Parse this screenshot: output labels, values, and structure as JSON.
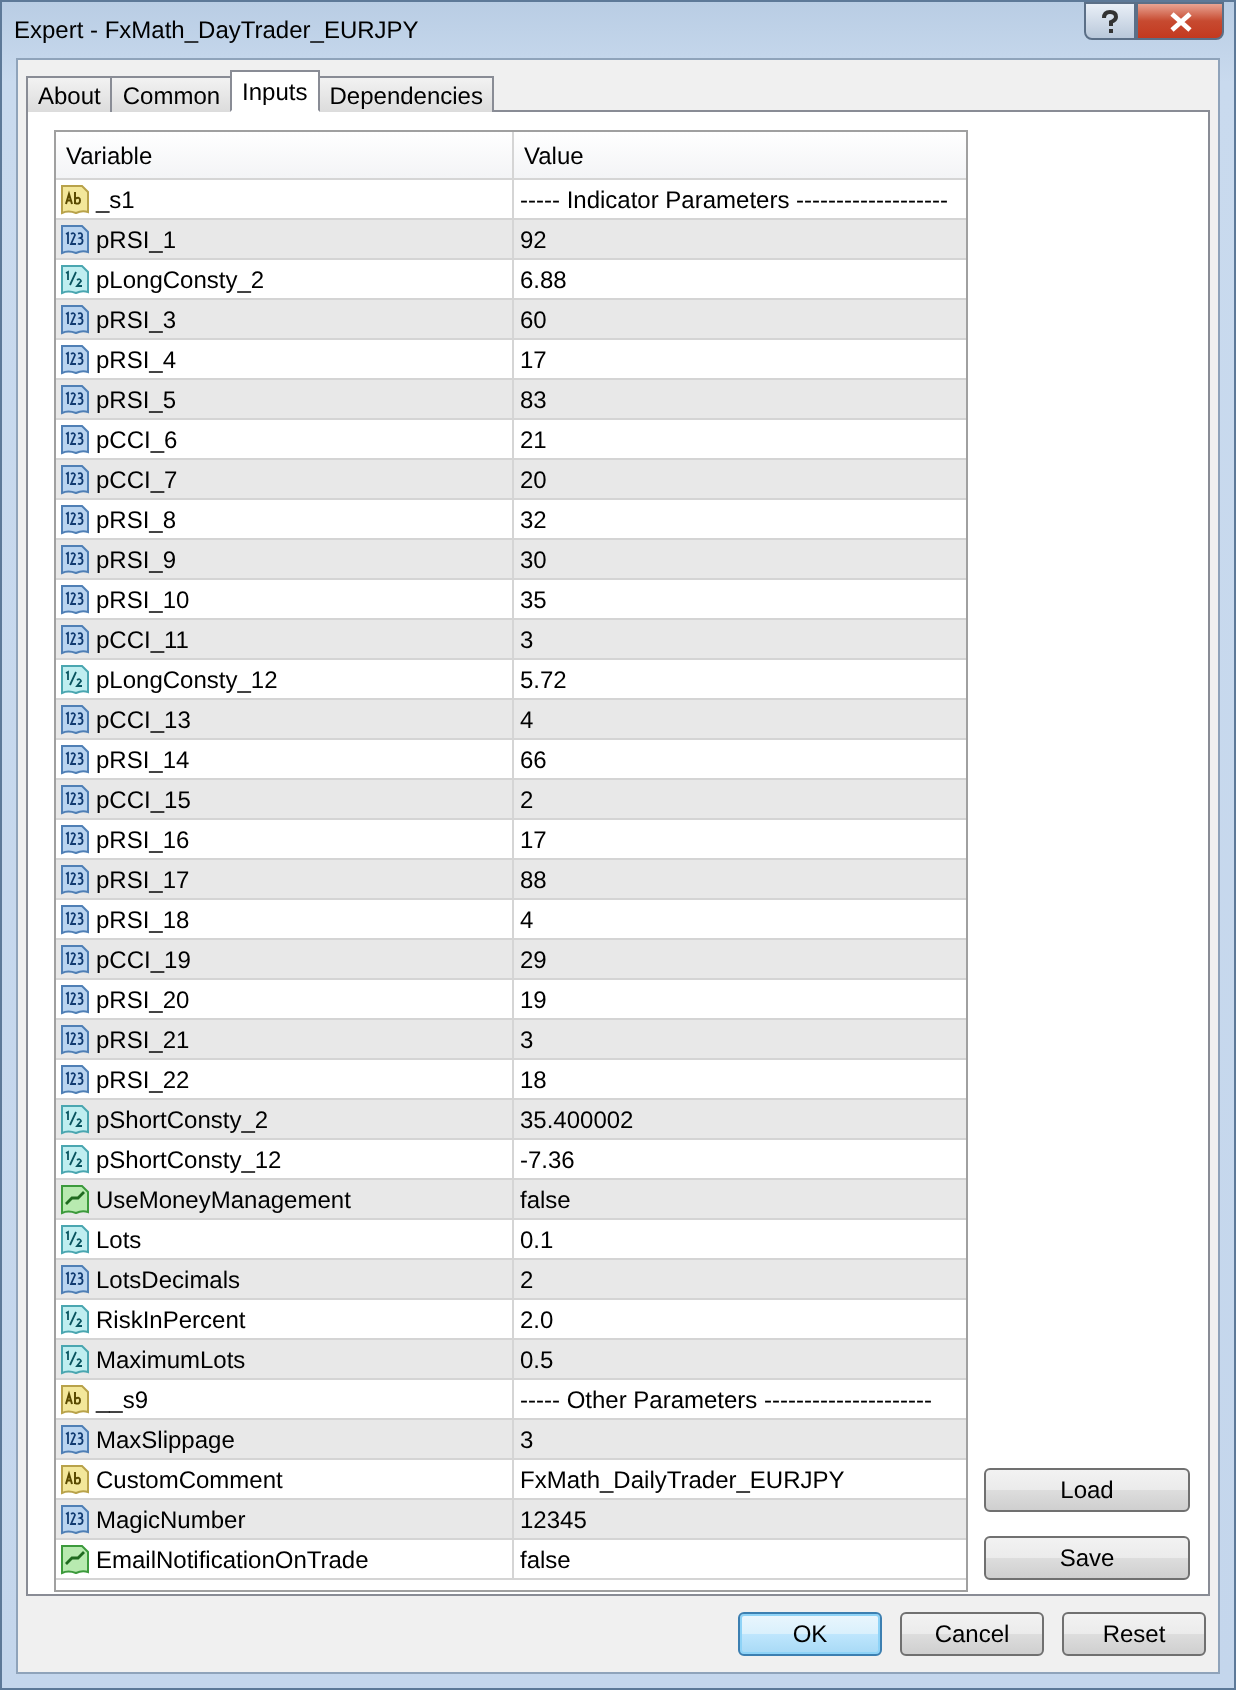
{
  "window": {
    "title": "Expert - FxMath_DayTrader_EURJPY"
  },
  "tabs": [
    {
      "label": "About",
      "selected": false
    },
    {
      "label": "Common",
      "selected": false
    },
    {
      "label": "Inputs",
      "selected": true
    },
    {
      "label": "Dependencies",
      "selected": false
    }
  ],
  "table": {
    "columns": [
      "Variable",
      "Value"
    ],
    "rows": [
      {
        "kind": "string",
        "variable": "_s1",
        "value": "-----  Indicator Parameters  -------------------"
      },
      {
        "kind": "int",
        "variable": "pRSI_1",
        "value": "92"
      },
      {
        "kind": "double",
        "variable": "pLongConsty_2",
        "value": "6.88"
      },
      {
        "kind": "int",
        "variable": "pRSI_3",
        "value": "60"
      },
      {
        "kind": "int",
        "variable": "pRSI_4",
        "value": "17"
      },
      {
        "kind": "int",
        "variable": "pRSI_5",
        "value": "83"
      },
      {
        "kind": "int",
        "variable": "pCCI_6",
        "value": "21"
      },
      {
        "kind": "int",
        "variable": "pCCI_7",
        "value": "20"
      },
      {
        "kind": "int",
        "variable": "pRSI_8",
        "value": "32"
      },
      {
        "kind": "int",
        "variable": "pRSI_9",
        "value": "30"
      },
      {
        "kind": "int",
        "variable": "pRSI_10",
        "value": "35"
      },
      {
        "kind": "int",
        "variable": "pCCI_11",
        "value": "3"
      },
      {
        "kind": "double",
        "variable": "pLongConsty_12",
        "value": "5.72"
      },
      {
        "kind": "int",
        "variable": "pCCI_13",
        "value": "4"
      },
      {
        "kind": "int",
        "variable": "pRSI_14",
        "value": "66"
      },
      {
        "kind": "int",
        "variable": "pCCI_15",
        "value": "2"
      },
      {
        "kind": "int",
        "variable": "pRSI_16",
        "value": "17"
      },
      {
        "kind": "int",
        "variable": "pRSI_17",
        "value": "88"
      },
      {
        "kind": "int",
        "variable": "pRSI_18",
        "value": "4"
      },
      {
        "kind": "int",
        "variable": "pCCI_19",
        "value": "29"
      },
      {
        "kind": "int",
        "variable": "pRSI_20",
        "value": "19"
      },
      {
        "kind": "int",
        "variable": "pRSI_21",
        "value": "3"
      },
      {
        "kind": "int",
        "variable": "pRSI_22",
        "value": "18"
      },
      {
        "kind": "double",
        "variable": "pShortConsty_2",
        "value": "35.400002"
      },
      {
        "kind": "double",
        "variable": "pShortConsty_12",
        "value": "-7.36"
      },
      {
        "kind": "bool",
        "variable": "UseMoneyManagement",
        "value": "false"
      },
      {
        "kind": "double",
        "variable": "Lots",
        "value": "0.1"
      },
      {
        "kind": "int",
        "variable": "LotsDecimals",
        "value": "2"
      },
      {
        "kind": "double",
        "variable": "RiskInPercent",
        "value": "2.0"
      },
      {
        "kind": "double",
        "variable": "MaximumLots",
        "value": "0.5"
      },
      {
        "kind": "string",
        "variable": "__s9",
        "value": "-----  Other Parameters  ---------------------"
      },
      {
        "kind": "int",
        "variable": "MaxSlippage",
        "value": "3"
      },
      {
        "kind": "string",
        "variable": "CustomComment",
        "value": "FxMath_DailyTrader_EURJPY"
      },
      {
        "kind": "int",
        "variable": "MagicNumber",
        "value": "12345"
      },
      {
        "kind": "bool",
        "variable": "EmailNotificationOnTrade",
        "value": "false"
      }
    ]
  },
  "side_buttons": [
    "Load",
    "Save"
  ],
  "buttons": [
    "OK",
    "Cancel",
    "Reset"
  ]
}
